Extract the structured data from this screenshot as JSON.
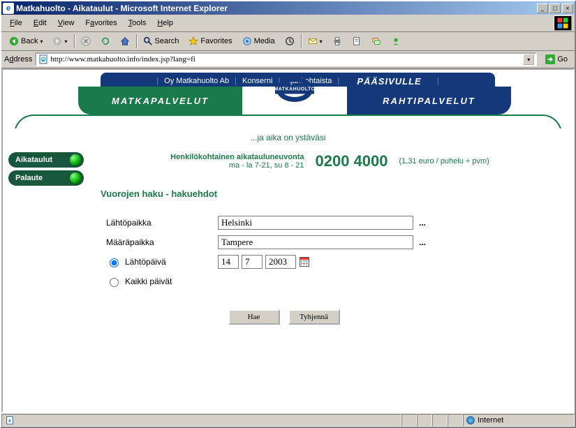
{
  "window": {
    "title": "Matkahuolto - Aikataulut - Microsoft Internet Explorer"
  },
  "menu": {
    "file": "File",
    "edit": "Edit",
    "view": "View",
    "favorites": "Favorites",
    "tools": "Tools",
    "help": "Help"
  },
  "toolbar": {
    "back": "Back",
    "search": "Search",
    "favorites": "Favorites",
    "media": "Media"
  },
  "address": {
    "label": "Address",
    "url": "http://www.matkahuolto.info/index.jsp?lang=fi",
    "go": "Go"
  },
  "topnav": {
    "i1": "Oy Matkahuolto Ab",
    "i2": "Konserni",
    "i3": "Ajankohtaista",
    "main": "PÄÄSIVULLE"
  },
  "tabs": {
    "left": "MATKAPALVELUT",
    "right": "RAHTIPALVELUT",
    "logo": "MATKAHUOLTO"
  },
  "slogan": "...ja aika on ystäväsi",
  "side": {
    "a": "Aikataulut",
    "b": "Palaute"
  },
  "advice": {
    "l1": "Henkilökohtainen aikatauluneuvonta",
    "l2": "ma - la 7-21, su 8 - 21",
    "phone": "0200 4000",
    "price": "(1,31 euro / puhelu + pvm)"
  },
  "section": "Vuorojen haku - hakuehdot",
  "form": {
    "from_label": "Lähtöpaikka",
    "from_value": "Helsinki",
    "to_label": "Määräpaikka",
    "to_value": "Tampere",
    "radio_date": "Lähtöpäivä",
    "radio_all": "Kaikki päivät",
    "day": "14",
    "month": "7",
    "year": "2003",
    "btn_search": "Hae",
    "btn_clear": "Tyhjennä"
  },
  "status": {
    "zone": "Internet"
  }
}
